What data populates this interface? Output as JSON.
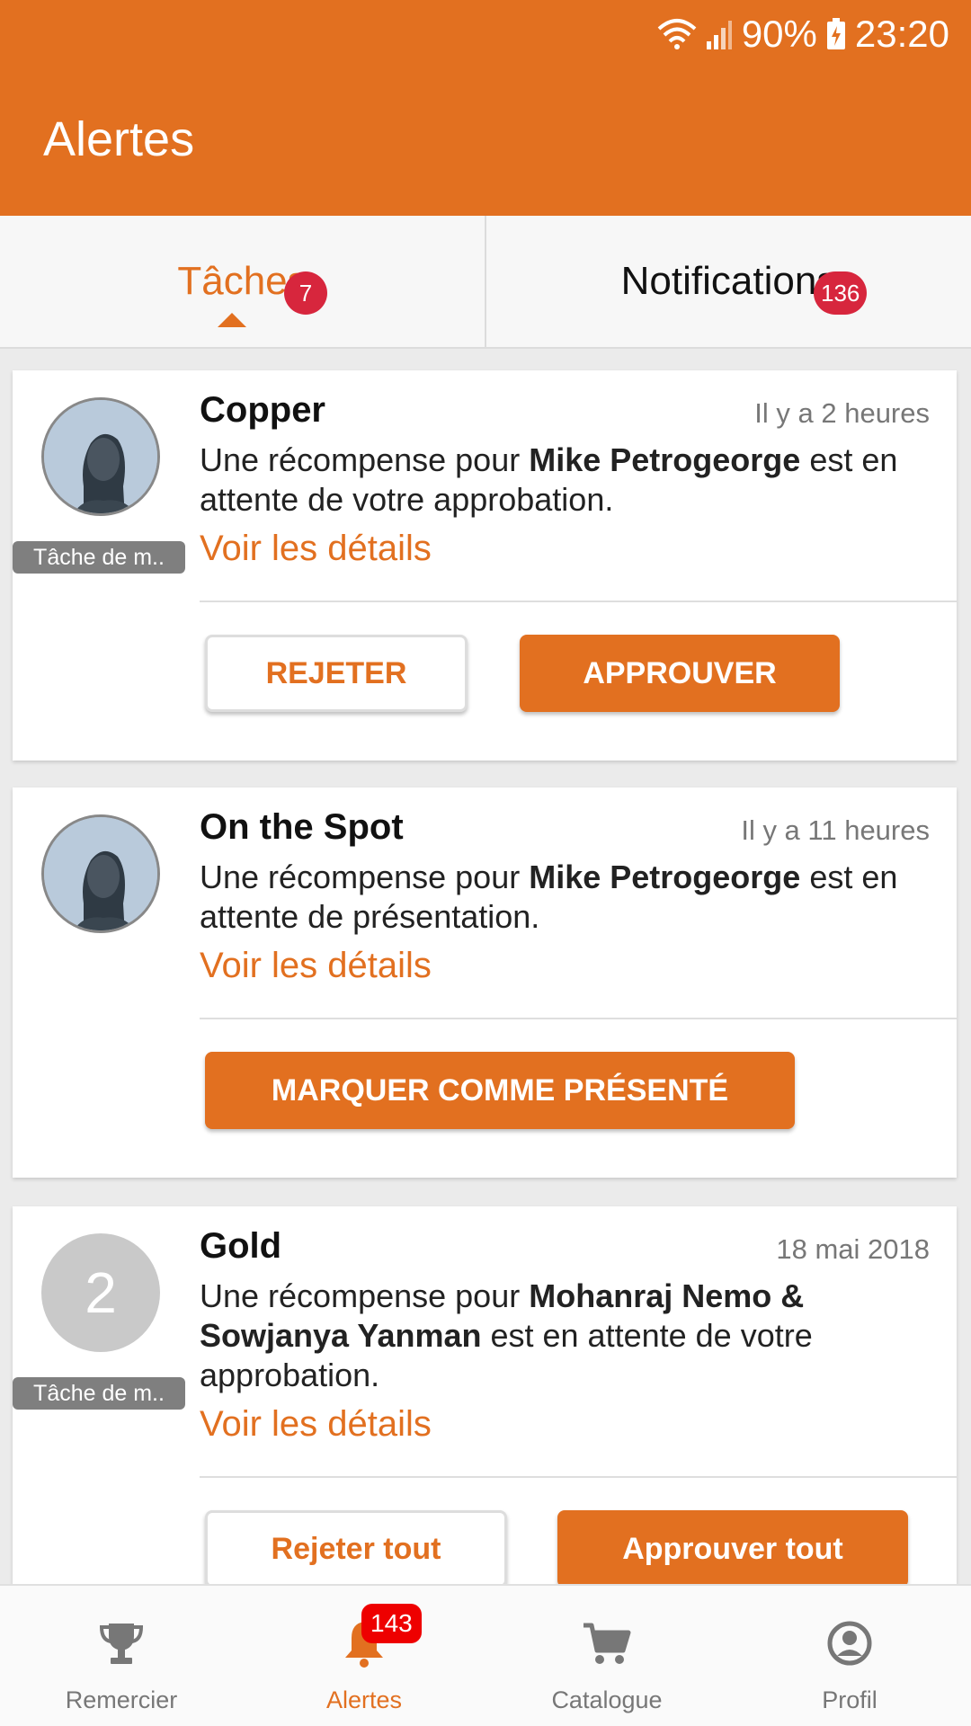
{
  "status_bar": {
    "battery": "90%",
    "time": "23:20"
  },
  "app": {
    "title": "Alertes"
  },
  "tabs": [
    {
      "label": "Tâches",
      "badge": "7",
      "active": true
    },
    {
      "label": "Notifications",
      "badge": "136",
      "active": false
    }
  ],
  "cards": [
    {
      "title": "Copper",
      "time": "Il y a 2 heures",
      "desc_prefix": "Une récompense pour ",
      "desc_bold": "Mike Petrogeorge",
      "desc_suffix": " est en attente de votre approbation.",
      "tag": "Tâche de m..",
      "details_link": "Voir les détails",
      "buttons": [
        "REJETER",
        "APPROUVER"
      ]
    },
    {
      "title": "On the Spot",
      "time": "Il y a 11 heures",
      "desc_prefix": "Une récompense pour ",
      "desc_bold": "Mike Petrogeorge",
      "desc_suffix": " est en attente de présentation.",
      "details_link": "Voir les détails",
      "buttons": [
        "MARQUER COMME PRÉSENTÉ"
      ]
    },
    {
      "title": "Gold",
      "time": "18 mai 2018",
      "avatar_count": "2",
      "desc_prefix": "Une récompense pour ",
      "desc_bold": "Mohanraj Nemo & Sowjanya Yanman",
      "desc_suffix": " est en attente de votre approbation.",
      "tag": "Tâche de m..",
      "details_link": "Voir les détails",
      "buttons": [
        "Rejeter tout",
        "Approuver tout"
      ]
    }
  ],
  "bottom_nav": [
    {
      "label": "Remercier",
      "icon": "trophy-icon"
    },
    {
      "label": "Alertes",
      "icon": "bell-icon",
      "badge": "143",
      "active": true
    },
    {
      "label": "Catalogue",
      "icon": "cart-icon"
    },
    {
      "label": "Profil",
      "icon": "profile-icon"
    }
  ],
  "colors": {
    "accent": "#E27020",
    "badge": "#d7263d"
  }
}
